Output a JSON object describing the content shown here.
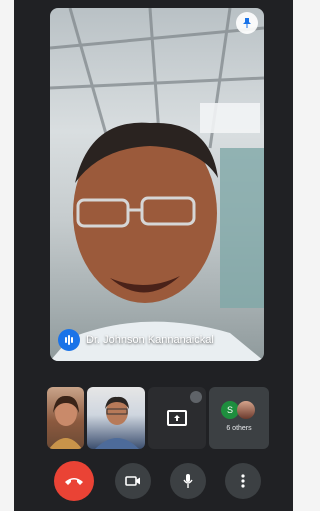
{
  "call": {
    "active_speaker": "Dr. Johnson Kannanaickal",
    "others_initial": "S",
    "others_count_label": "6 others"
  },
  "icons": {
    "pin": "pin-icon",
    "speaking": "audio-wave-icon",
    "present": "present-screen-icon",
    "end_call": "call-end-icon",
    "camera": "videocam-icon",
    "mic": "mic-icon",
    "more": "more-vert-icon"
  },
  "colors": {
    "background": "#202124",
    "end_call": "#ea4335",
    "speaking_indicator": "#1a73e8",
    "control_button": "#3c4043"
  }
}
